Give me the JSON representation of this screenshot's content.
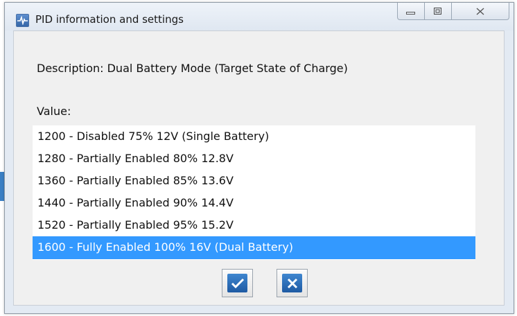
{
  "window": {
    "title": "PID information and settings",
    "icon": "pulse-icon",
    "caption_buttons": [
      "minimize-icon",
      "maximize-icon",
      "close-icon"
    ]
  },
  "description": "Description: Dual Battery Mode (Target State of Charge)",
  "value_label": "Value:",
  "values": [
    {
      "label": "1200 - Disabled 75% 12V (Single Battery)",
      "selected": false
    },
    {
      "label": "1280 - Partially Enabled 80% 12.8V",
      "selected": false
    },
    {
      "label": "1360 - Partially Enabled 85% 13.6V",
      "selected": false
    },
    {
      "label": "1440 - Partially Enabled 90% 14.4V",
      "selected": false
    },
    {
      "label": "1520 - Partially Enabled 95% 15.2V",
      "selected": false
    },
    {
      "label": "1600 - Fully Enabled 100% 16V (Dual Battery)",
      "selected": true
    }
  ],
  "buttons": {
    "ok_icon": "checkmark-icon",
    "cancel_icon": "x-icon"
  },
  "colors": {
    "selection": "#3399ff",
    "button_face": "#2b6fb8",
    "background": "#f0f0f0"
  }
}
